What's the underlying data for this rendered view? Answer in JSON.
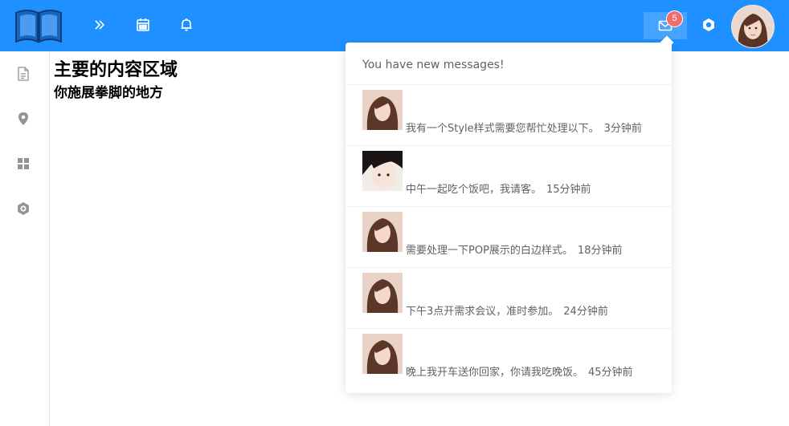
{
  "colors": {
    "accent": "#1e90ff",
    "badge": "#f56c6c",
    "text_muted": "#606266",
    "sidebar_icon": "#909399"
  },
  "header": {
    "logo_icon": "book-logo-icon",
    "icons": [
      "expand-icon",
      "calendar-icon",
      "bell-icon",
      "mail-icon",
      "settings-icon"
    ],
    "message_count": "5"
  },
  "sidebar": {
    "items": [
      {
        "icon": "document-icon"
      },
      {
        "icon": "location-icon"
      },
      {
        "icon": "grid-icon"
      },
      {
        "icon": "settings-icon"
      }
    ]
  },
  "main": {
    "title": "主要的内容区域",
    "subtitle": "你施展拳脚的地方"
  },
  "popover": {
    "header": "You have new messages!",
    "messages": [
      {
        "text": "我有一个Style样式需要您帮忙处理以下。",
        "time": "3分钟前"
      },
      {
        "text": "中午一起吃个饭吧，我请客。",
        "time": "15分钟前"
      },
      {
        "text": "需要处理一下POP展示的白边样式。",
        "time": "18分钟前"
      },
      {
        "text": "下午3点开需求会议，准时参加。",
        "time": "24分钟前"
      },
      {
        "text": "晚上我开车送你回家，你请我吃晚饭。",
        "time": "45分钟前"
      }
    ]
  }
}
